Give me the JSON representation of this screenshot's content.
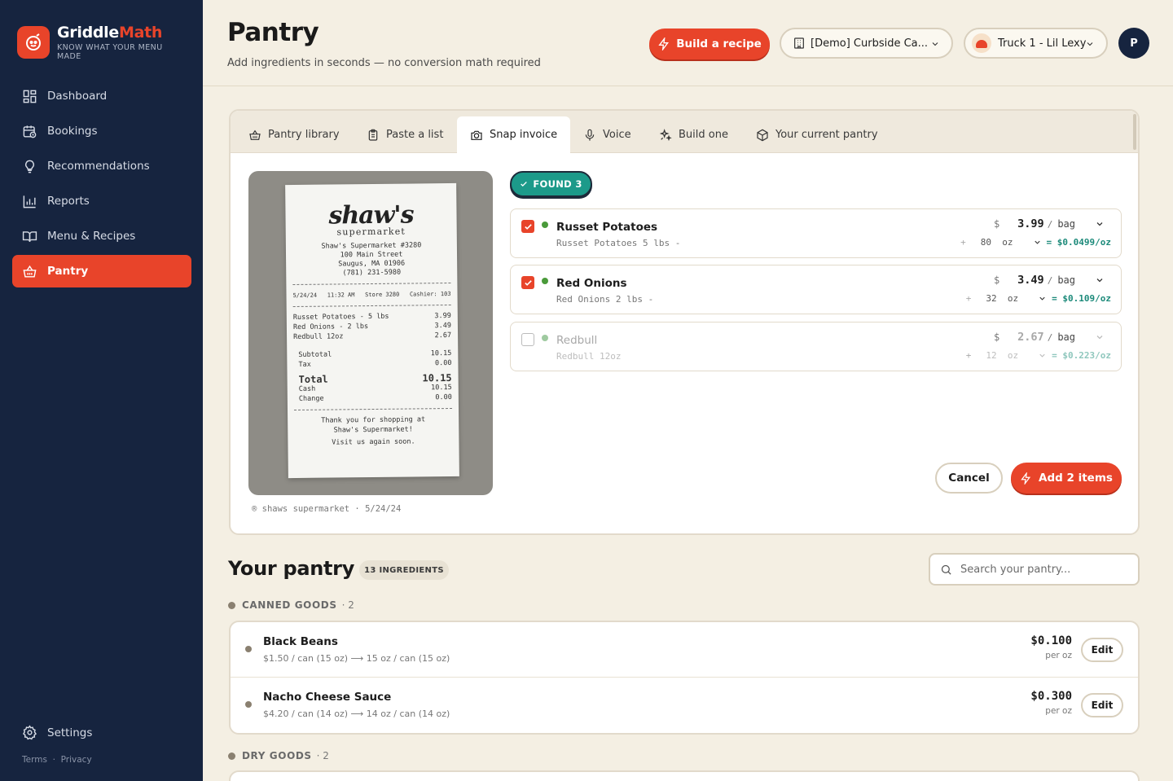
{
  "brand": {
    "name_a": "Griddle",
    "name_b": "Math",
    "tagline": "KNOW WHAT YOUR MENU MADE"
  },
  "nav": [
    {
      "label": "Dashboard",
      "icon": "grid-icon"
    },
    {
      "label": "Bookings",
      "icon": "calendar-icon"
    },
    {
      "label": "Recommendations",
      "icon": "lightbulb-icon"
    },
    {
      "label": "Reports",
      "icon": "bar-chart-icon"
    },
    {
      "label": "Menu & Recipes",
      "icon": "book-icon"
    },
    {
      "label": "Pantry",
      "icon": "basket-icon",
      "active": true
    }
  ],
  "settings_label": "Settings",
  "legal": {
    "terms": "Terms",
    "sep": "·",
    "privacy": "Privacy"
  },
  "header": {
    "title": "Pantry",
    "subtitle": "Add ingredients in seconds — no conversion math required",
    "build_recipe": "Build a recipe",
    "location": "[Demo] Curbside Ca...",
    "truck": "Truck 1 - Lil Lexy",
    "avatar": "P"
  },
  "tabs": [
    {
      "label": "Pantry library"
    },
    {
      "label": "Paste a list"
    },
    {
      "label": "Snap invoice",
      "active": true
    },
    {
      "label": "Voice"
    },
    {
      "label": "Build one"
    },
    {
      "label": "Your current pantry"
    }
  ],
  "receipt": {
    "brand": "shaw's",
    "sub": "supermarket",
    "store_lines": [
      "Shaw's Supermarket #3280",
      "100 Main Street",
      "Saugus, MA 01906",
      "(781) 231-5980"
    ],
    "date": "5/24/24",
    "time": "11:32 AM",
    "store": "Store 3280",
    "cashier": "Cashier: 103",
    "items": [
      {
        "name": "Russet Potatoes - 5 lbs",
        "price": "3.99"
      },
      {
        "name": "Red Onions - 2 lbs",
        "price": "3.49"
      },
      {
        "name": "Redbull 12oz",
        "price": "2.67"
      }
    ],
    "subtotal_label": "Subtotal",
    "subtotal": "10.15",
    "tax_label": "Tax",
    "tax": "0.00",
    "total_label": "Total",
    "total": "10.15",
    "cash_label": "Cash",
    "cash": "10.15",
    "change_label": "Change",
    "change": "0.00",
    "thanks": [
      "Thank you for shopping at",
      "Shaw's Supermarket!",
      "Visit us again soon."
    ],
    "caption": "® shaws supermarket · 5/24/24"
  },
  "found_label": "FOUND 3",
  "items": [
    {
      "name": "Russet Potatoes",
      "raw": "Russet Potatoes 5 lbs -",
      "currency": "$",
      "price": "3.99",
      "per": "/",
      "unit": "bag",
      "qty": "80",
      "qty_unit": "oz",
      "result": "= $0.0499/oz",
      "checked": true
    },
    {
      "name": "Red Onions",
      "raw": "Red Onions 2 lbs -",
      "currency": "$",
      "price": "3.49",
      "per": "/",
      "unit": "bag",
      "qty": "32",
      "qty_unit": "oz",
      "result": "= $0.109/oz",
      "checked": true
    },
    {
      "name": "Redbull",
      "raw": "Redbull 12oz",
      "currency": "$",
      "price": "2.67",
      "per": "/",
      "unit": "bag",
      "qty": "12",
      "qty_unit": "oz",
      "result": "= $0.223/oz",
      "checked": false
    }
  ],
  "actions": {
    "cancel": "Cancel",
    "add": "Add 2 items"
  },
  "your_pantry": {
    "title": "Your pantry",
    "count": "13 INGREDIENTS",
    "search_placeholder": "Search your pantry...",
    "categories": [
      {
        "name": "CANNED GOODS",
        "count": "· 2"
      },
      {
        "name": "DRY GOODS",
        "count": "· 2"
      }
    ],
    "rows": [
      {
        "name": "Black Beans",
        "desc": "$1.50 / can (15 oz) ⟶ 15 oz / can (15 oz)",
        "price": "$0.100",
        "per": "per oz",
        "edit": "Edit"
      },
      {
        "name": "Nacho Cheese Sauce",
        "desc": "$4.20 / can (14 oz) ⟶ 14 oz / can (14 oz)",
        "price": "$0.300",
        "per": "per oz",
        "edit": "Edit"
      }
    ]
  },
  "colors": {
    "accent": "#e8442a",
    "sidebar": "#16243f",
    "teal": "#1c9a8a",
    "bg": "#f4efe3"
  }
}
